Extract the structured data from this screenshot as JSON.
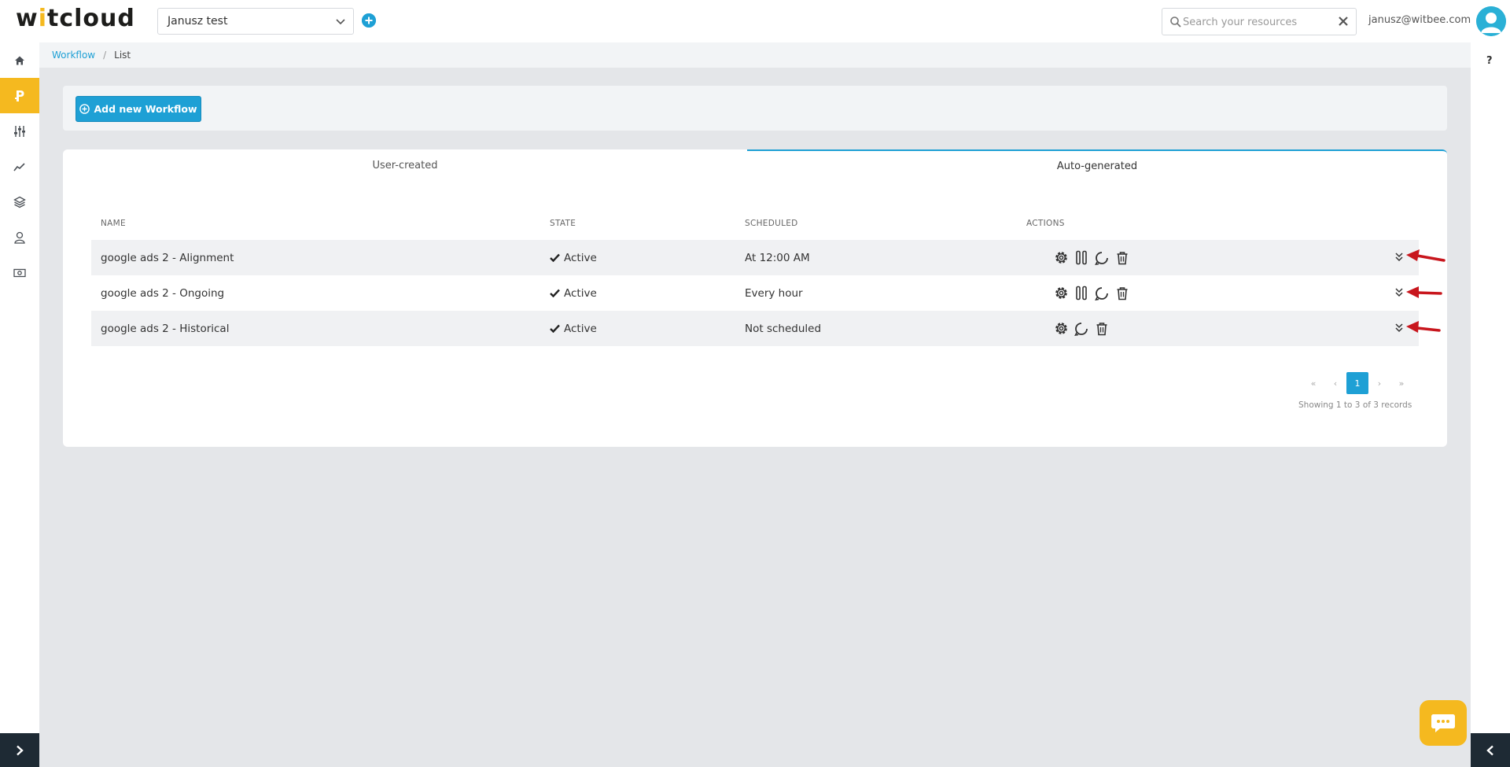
{
  "app": {
    "logo_pre": "w",
    "logo_accent": "i",
    "logo_post": "tcloud"
  },
  "header": {
    "organization": "Janusz test",
    "search_placeholder": "Search your resources",
    "user_email": "janusz@witbee.com"
  },
  "sidebar": {
    "items": [
      {
        "icon": "home-icon",
        "active": false
      },
      {
        "icon": "workflow-icon",
        "active": true
      },
      {
        "icon": "sliders-icon",
        "active": false
      },
      {
        "icon": "chart-line-icon",
        "active": false
      },
      {
        "icon": "layers-icon",
        "active": false
      },
      {
        "icon": "user-icon",
        "active": false
      },
      {
        "icon": "money-icon",
        "active": false
      }
    ]
  },
  "right_rail": {
    "help_label": "?"
  },
  "breadcrumb": {
    "link": "Workflow",
    "separator": "/",
    "current": "List"
  },
  "toolbar": {
    "add_label": "Add new Workflow"
  },
  "tabs": [
    {
      "label": "User-created",
      "active": false
    },
    {
      "label": "Auto-generated",
      "active": true
    }
  ],
  "table": {
    "headers": {
      "name": "NAME",
      "state": "STATE",
      "scheduled": "SCHEDULED",
      "actions": "ACTIONS"
    },
    "rows": [
      {
        "name": "google ads 2 - Alignment",
        "state": "Active",
        "scheduled": "At 12:00 AM",
        "actions": [
          "settings",
          "pause",
          "refresh",
          "delete"
        ]
      },
      {
        "name": "google ads 2 - Ongoing",
        "state": "Active",
        "scheduled": "Every hour",
        "actions": [
          "settings",
          "pause",
          "refresh",
          "delete"
        ]
      },
      {
        "name": "google ads 2 - Historical",
        "state": "Active",
        "scheduled": "Not scheduled",
        "actions": [
          "settings",
          "refresh",
          "delete"
        ]
      }
    ]
  },
  "pagination": {
    "first": "«",
    "prev": "‹",
    "page": "1",
    "next": "›",
    "last": "»",
    "info": "Showing 1 to 3 of 3 records"
  },
  "colors": {
    "accent": "#1ea0d5",
    "brand_yellow": "#f5b91f",
    "annotation_red": "#c8161d"
  }
}
